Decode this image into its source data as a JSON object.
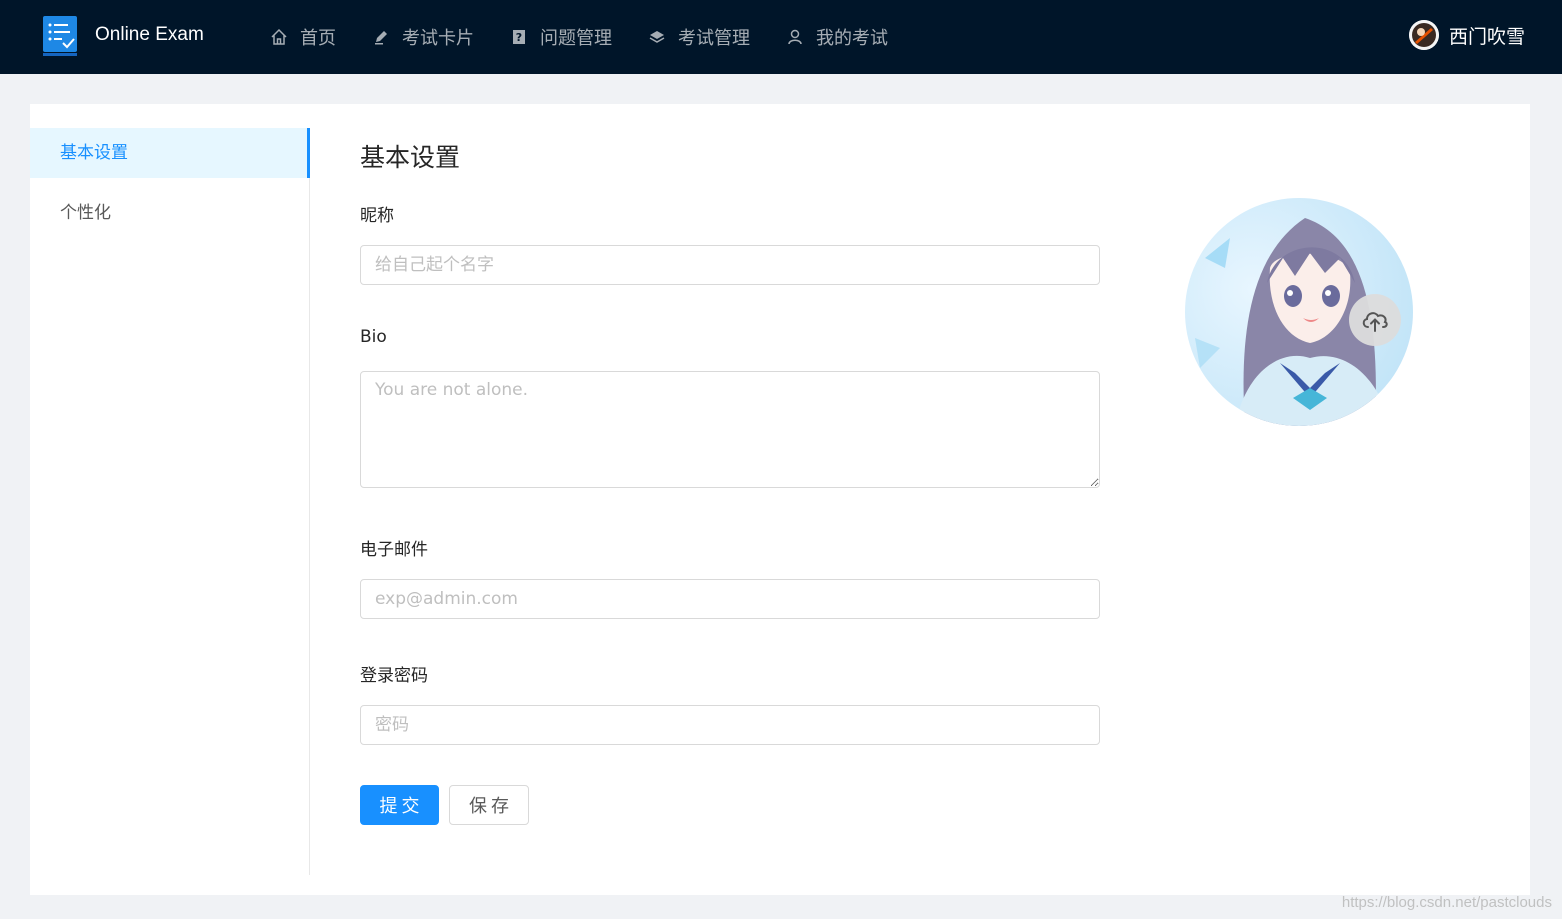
{
  "header": {
    "app_title": "Online Exam",
    "nav": [
      {
        "label": "首页",
        "icon": "home-icon"
      },
      {
        "label": "考试卡片",
        "icon": "edit-icon"
      },
      {
        "label": "问题管理",
        "icon": "question-icon"
      },
      {
        "label": "考试管理",
        "icon": "layers-icon"
      },
      {
        "label": "我的考试",
        "icon": "user-icon"
      }
    ],
    "user_name": "西门吹雪"
  },
  "sidebar": {
    "items": [
      {
        "label": "基本设置",
        "active": true
      },
      {
        "label": "个性化",
        "active": false
      }
    ]
  },
  "form": {
    "title": "基本设置",
    "nickname_label": "昵称",
    "nickname_placeholder": "给自己起个名字",
    "bio_label": "Bio",
    "bio_placeholder": "You are not alone.",
    "email_label": "电子邮件",
    "email_placeholder": "exp@admin.com",
    "password_label": "登录密码",
    "password_placeholder": "密码",
    "submit_label": "提交",
    "save_label": "保存"
  },
  "avatar": {
    "upload_icon": "cloud-upload-icon"
  },
  "watermark": "https://blog.csdn.net/pastclouds",
  "colors": {
    "header_bg": "#001529",
    "primary": "#1890ff",
    "menu_active_bg": "#e6f7ff"
  }
}
